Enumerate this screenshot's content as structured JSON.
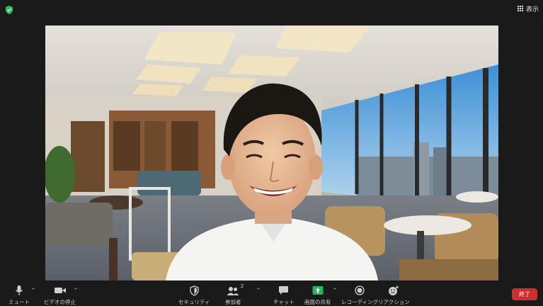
{
  "topbar": {
    "view_label": "表示"
  },
  "toolbar": {
    "mute_label": "ミュート",
    "stop_video_label": "ビデオの停止",
    "security_label": "セキュリティ",
    "participants_label": "参加者",
    "participants_count": "2",
    "chat_label": "チャット",
    "share_label": "画面の共有",
    "record_label": "レコーディング",
    "reactions_label": "リアクション",
    "end_label": "終了"
  },
  "colors": {
    "window_bg": "#1a1a1a",
    "end_button": "#d02d2d",
    "share_accent": "#23b85a",
    "encryption_shield": "#2bbf5c"
  },
  "icons": [
    "shield-icon",
    "grid-icon",
    "microphone-icon",
    "video-camera-icon",
    "security-shield-icon",
    "participants-icon",
    "chat-bubble-icon",
    "share-screen-icon",
    "record-icon",
    "reaction-icon"
  ]
}
